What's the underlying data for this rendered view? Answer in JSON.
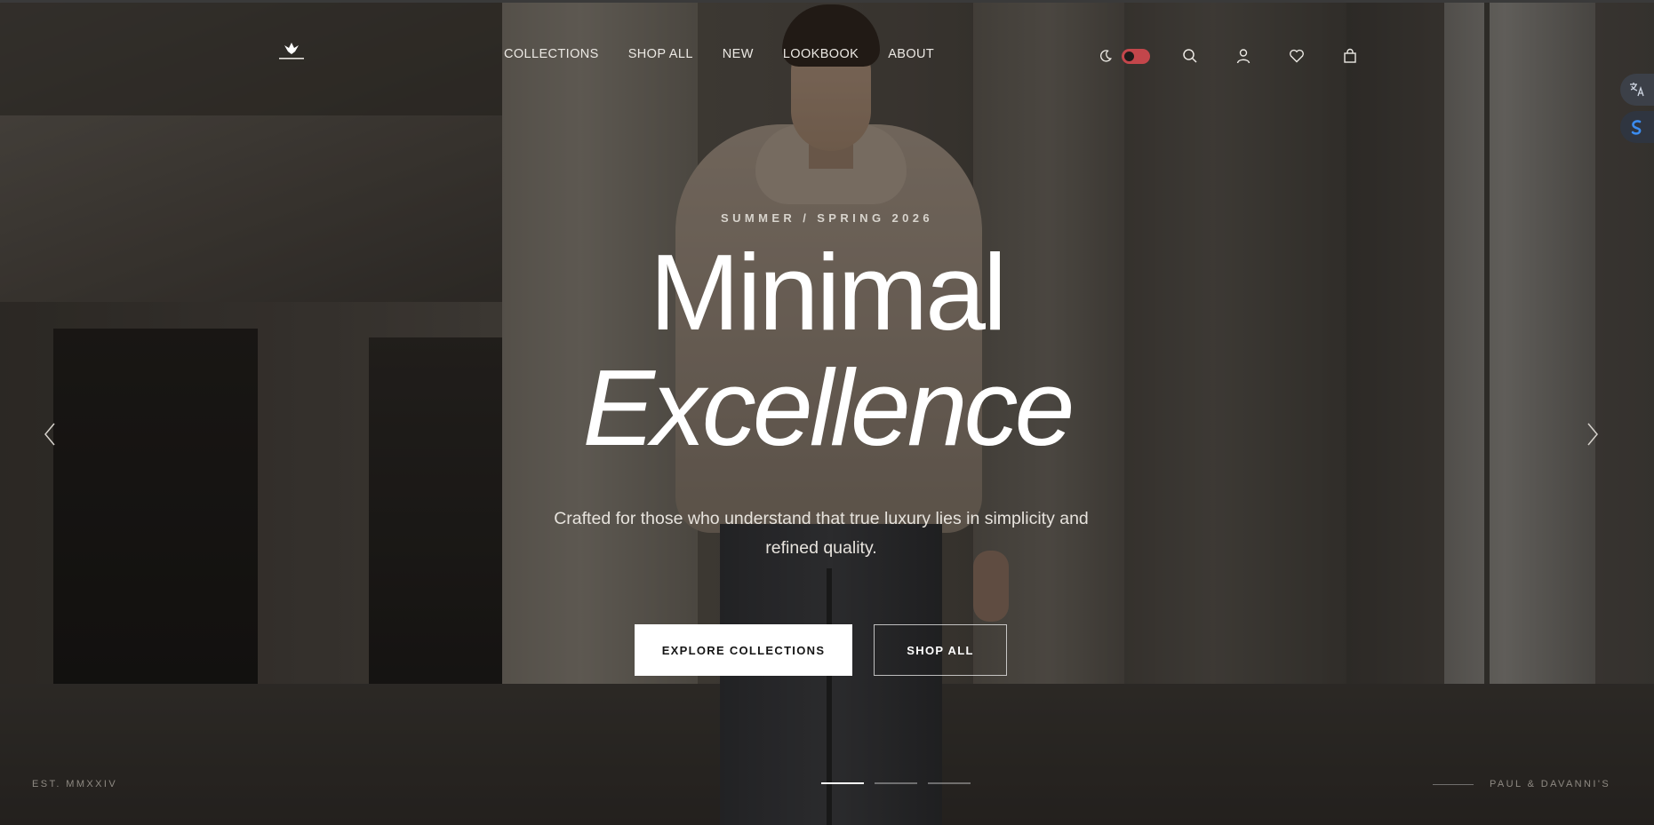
{
  "header": {
    "logo_icon": "eagle-logo-icon",
    "nav": [
      {
        "label": "COLLECTIONS"
      },
      {
        "label": "SHOP ALL"
      },
      {
        "label": "NEW"
      },
      {
        "label": "LOOKBOOK"
      },
      {
        "label": "ABOUT"
      }
    ],
    "tools": {
      "theme_icon": "moon-icon",
      "toggle_color": "#c3464b",
      "search_icon": "search-icon",
      "account_icon": "user-icon",
      "wishlist_icon": "heart-icon",
      "cart_icon": "bag-icon"
    }
  },
  "side_widgets": [
    "translate-icon",
    "extension-icon"
  ],
  "hero": {
    "eyebrow": "SUMMER / SPRING 2026",
    "title_line1": "Minimal",
    "title_line2": "Excellence",
    "subtitle": "Crafted for those who understand that true luxury lies in simplicity and refined quality.",
    "primary_cta": "EXPLORE COLLECTIONS",
    "secondary_cta": "SHOP ALL",
    "slides_total": 3,
    "active_slide": 1
  },
  "footer": {
    "est": "EST. MMXXIV",
    "brand": "PAUL & DAVANNI'S"
  },
  "colors": {
    "text": "#ffffff",
    "toggle_accent": "#c3464b",
    "muted": "#8f8a83"
  }
}
